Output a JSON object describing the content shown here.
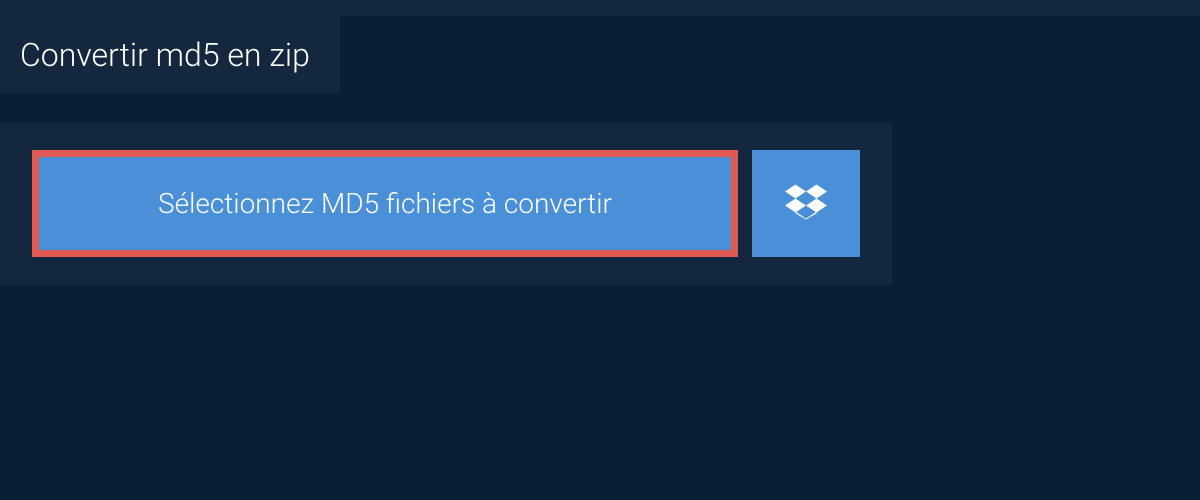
{
  "tab": {
    "title": "Convertir md5 en zip"
  },
  "panel": {
    "select_label": "Sélectionnez MD5 fichiers à convertir"
  },
  "colors": {
    "background_dark": "#0a1f33",
    "panel_dark": "#13283f",
    "button_blue": "#4990d8",
    "highlight_red": "#e05a54",
    "text_white": "#ffffff"
  }
}
